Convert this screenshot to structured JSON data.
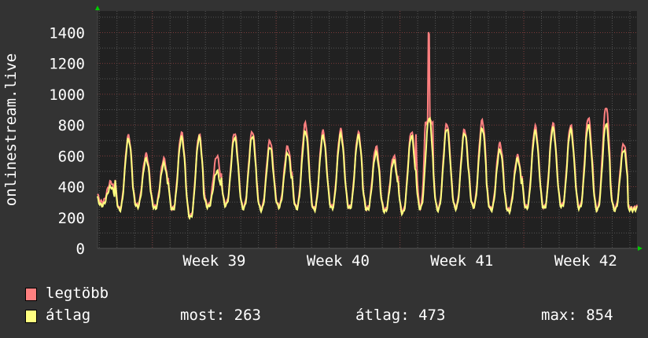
{
  "chart_data": {
    "type": "line",
    "ylabel": "onlinestream.live",
    "ylim": [
      0,
      1540
    ],
    "yticks": [
      0,
      200,
      400,
      600,
      800,
      1000,
      1200,
      1400
    ],
    "xtick_labels": [
      "Week 39",
      "Week 40",
      "Week 41",
      "Week 42"
    ],
    "days": 30.5,
    "series": [
      {
        "name": "legtöbb",
        "color": "#ff8080",
        "daily_peaks": [
          430,
          730,
          610,
          580,
          750,
          740,
          600,
          750,
          760,
          700,
          660,
          810,
          760,
          770,
          750,
          660,
          600,
          760,
          1400,
          810,
          770,
          830,
          680,
          600,
          790,
          810,
          800,
          850,
          920,
          680,
          300
        ],
        "daily_troughs": [
          300,
          260,
          280,
          270,
          260,
          210,
          280,
          290,
          270,
          260,
          280,
          270,
          260,
          270,
          270,
          260,
          250,
          240,
          270,
          260,
          270,
          280,
          260,
          250,
          270,
          270,
          280,
          270,
          260,
          260,
          260
        ]
      },
      {
        "name": "átlag",
        "color": "#ffff80",
        "daily_peaks": [
          400,
          710,
          580,
          550,
          720,
          720,
          500,
          720,
          730,
          660,
          620,
          760,
          730,
          740,
          730,
          620,
          570,
          730,
          850,
          780,
          750,
          780,
          640,
          580,
          760,
          780,
          770,
          800,
          810,
          640,
          280
        ],
        "daily_troughs": [
          280,
          250,
          270,
          260,
          250,
          200,
          270,
          280,
          260,
          250,
          270,
          260,
          250,
          260,
          260,
          250,
          240,
          230,
          260,
          250,
          260,
          270,
          250,
          240,
          260,
          260,
          270,
          260,
          250,
          250,
          250
        ]
      }
    ],
    "stats": {
      "most": "most: 263",
      "atlag": "átlag: 473",
      "max": "max: 854"
    }
  }
}
